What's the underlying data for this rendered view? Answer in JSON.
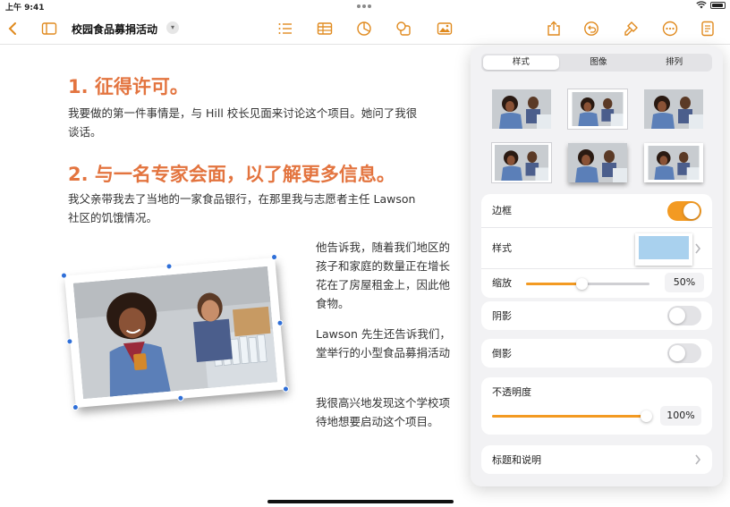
{
  "status": {
    "time": "上午 9:41"
  },
  "toolbar": {
    "doc_title": "校园食品募捐活动"
  },
  "document": {
    "heading1": "1.  征得许可。",
    "para1_line1": "我要做的第一件事情是，与 Hill 校长见面来讨论这个项目。她问了我很",
    "para1_line2": "谈话。",
    "heading2": "2. 与一名专家会面，以了解更多信息。",
    "para2_line1": "我父亲带我去了当地的一家食品银行，在那里我与志愿者主任 Lawson",
    "para2_line2": "社区的饥饿情况。",
    "col_lines": [
      "他告诉我，随着我们地区的",
      "孩子和家庭的数量正在增长",
      "花在了房屋租金上，因此他",
      "食物。",
      "Lawson 先生还告诉我们，",
      "堂举行的小型食品募捐活动",
      "我很高兴地发现这个学校项",
      "待地想要启动这个项目。"
    ]
  },
  "panel": {
    "tabs": [
      "样式",
      "图像",
      "排列"
    ],
    "active_tab": "样式",
    "border_label": "边框",
    "style_label": "样式",
    "scale_label": "缩放",
    "scale_value": "50%",
    "scale_fraction": 0.45,
    "shadow_label": "阴影",
    "reflection_label": "倒影",
    "opacity_label": "不透明度",
    "opacity_value": "100%",
    "opacity_fraction": 1.0,
    "caption_label": "标题和说明",
    "border_on": true,
    "shadow_on": false,
    "reflection_on": false
  },
  "colors": {
    "accent": "#f39a22",
    "heading": "#e3743f",
    "selection": "#2f6fd8"
  },
  "icons": [
    "back-chevron-icon",
    "sidebar-icon",
    "list-icon",
    "table-icon",
    "chart-icon",
    "shapes-icon",
    "media-icon",
    "share-icon",
    "undo-icon",
    "format-brush-icon",
    "more-icon",
    "document-icon"
  ]
}
